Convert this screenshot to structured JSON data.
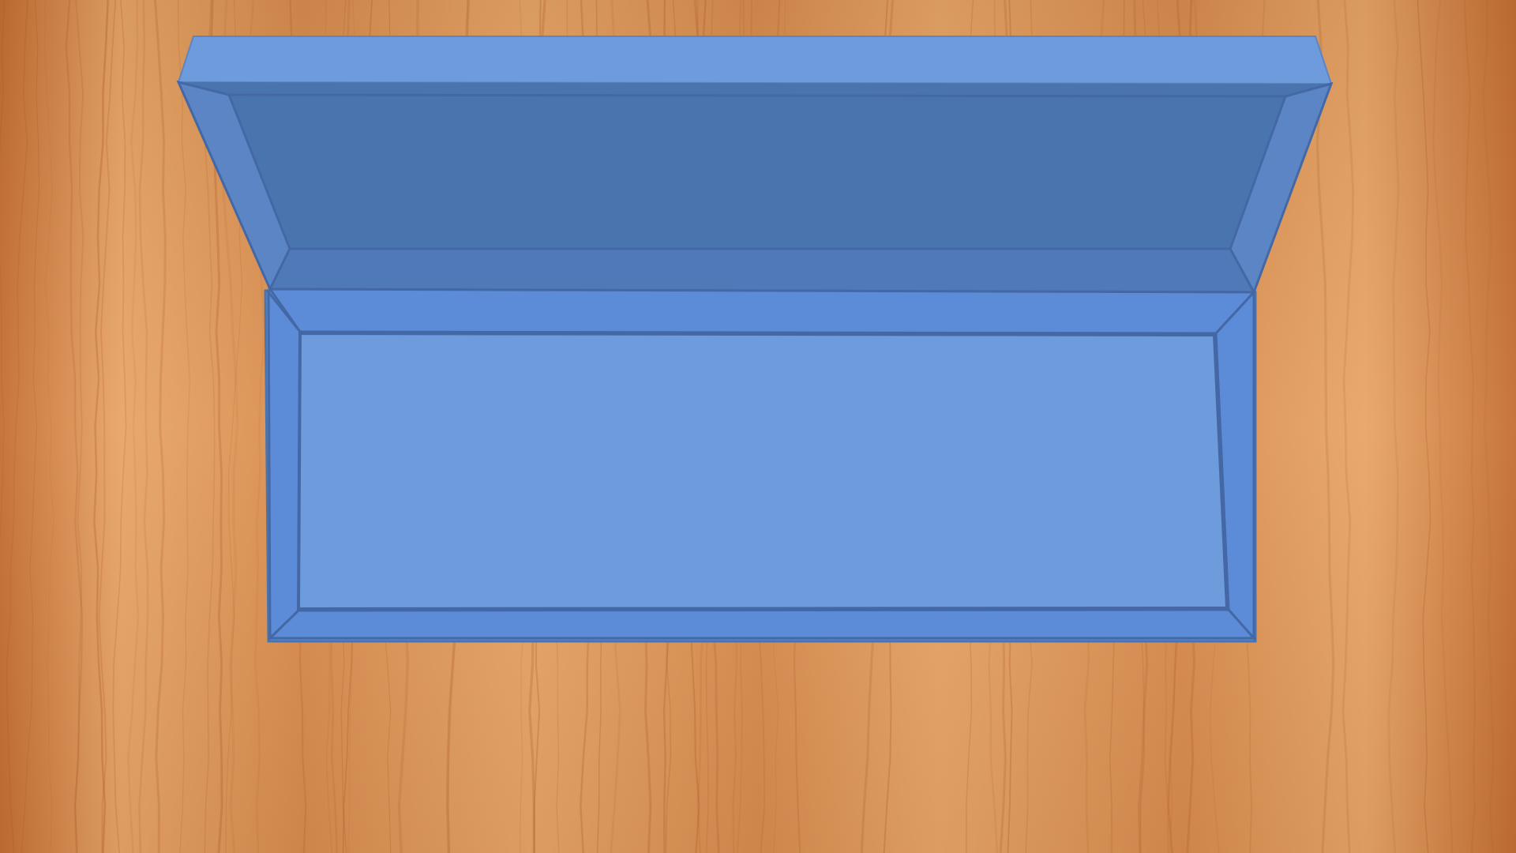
{
  "scene": {
    "background": {
      "material": "wood-grain",
      "colors": {
        "light": "#E8A566",
        "mid": "#D88C4E",
        "dark": "#C46F33"
      }
    },
    "box": {
      "state": "open",
      "colors": {
        "lid_rim": "#6E9BDB",
        "lid_inner": "#4A74AD",
        "lid_side": "#5B85C4",
        "outline": "#4468A5",
        "tray_wall": "#5C8CD8",
        "tray_floor": "#6E9BDB"
      }
    }
  }
}
